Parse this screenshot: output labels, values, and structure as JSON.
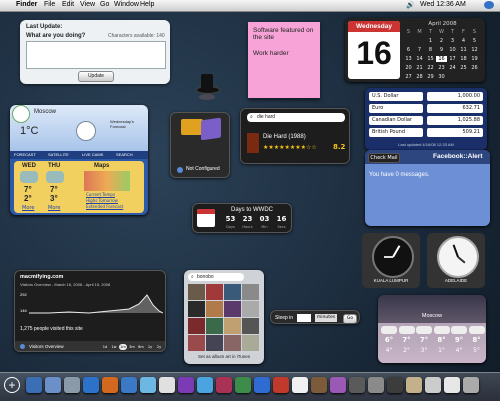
{
  "menubar": {
    "app": "Finder",
    "items": [
      "File",
      "Edit",
      "View",
      "Go",
      "Window",
      "Help"
    ],
    "clock": "Wed 12:36 AM"
  },
  "twitter": {
    "title": "Last Update:",
    "prompt": "What are you doing?",
    "chars": "Characters available: 140",
    "button": "Update"
  },
  "sticky": {
    "line1": "Software featured on the site",
    "line2": "Work harder"
  },
  "calendar": {
    "weekday": "Wednesday",
    "day": "16",
    "month": "April 2008",
    "dow": [
      "S",
      "M",
      "T",
      "W",
      "T",
      "F",
      "S"
    ],
    "weeks": [
      [
        "",
        "",
        "1",
        "2",
        "3",
        "4",
        "5"
      ],
      [
        "6",
        "7",
        "8",
        "9",
        "10",
        "11",
        "12"
      ],
      [
        "13",
        "14",
        "15",
        "16",
        "17",
        "18",
        "19"
      ],
      [
        "20",
        "21",
        "22",
        "23",
        "24",
        "25",
        "26"
      ],
      [
        "27",
        "28",
        "29",
        "30",
        "",
        "",
        ""
      ]
    ]
  },
  "weather": {
    "city": "Moscow",
    "temp": "1°C",
    "forecast_title": "Wednesday's Forecast",
    "tabs": [
      "FORECAST",
      "SATELLITE",
      "LIVE CAMS",
      "SEARCH"
    ],
    "days": [
      {
        "name": "WED",
        "hi": "7°",
        "lo": "2°",
        "link": "More"
      },
      {
        "name": "THU",
        "hi": "7°",
        "lo": "3°",
        "link": "More"
      }
    ],
    "maps_label": "Maps",
    "map_links": [
      "Current Temps",
      "Highs Tomorrow",
      "Extended Forecast"
    ]
  },
  "delivery": {
    "status": "Not Configured"
  },
  "movies": {
    "search": "die hard",
    "result_title": "Die Hard (1988)",
    "rating": "8.2"
  },
  "currency": {
    "rows": [
      {
        "name": "U.S. Dollar",
        "value": "1,000.00"
      },
      {
        "name": "Euro",
        "value": "632.71"
      },
      {
        "name": "Canadian Dollar",
        "value": "1,025.88"
      },
      {
        "name": "British Pound",
        "value": "509.21"
      }
    ],
    "footer": "Last updated 4/16/08 12:33 AM"
  },
  "facebook": {
    "button": "Check Mail",
    "title": "Facebook::Alert",
    "message": "You have 0 messages."
  },
  "countdown": {
    "title": "Days to WWDC",
    "values": [
      "53",
      "23",
      "03",
      "16"
    ],
    "labels": [
      "Days",
      "Hours",
      "Min",
      "Secs"
    ]
  },
  "clocks": [
    {
      "city": "KUALA LUMPUR"
    },
    {
      "city": "ADELAIDE"
    }
  ],
  "analytics": {
    "site": "macmifying.com",
    "subtitle": "Visitors Overview - March 16, 2008 - April 15, 2008",
    "ymax": "292",
    "ymin": "146",
    "visits": "1,275 people visited this site",
    "footer": "Visitors Overview",
    "ranges": [
      "1d",
      "1w",
      "1m",
      "3m",
      "6m",
      "1y",
      "2y"
    ]
  },
  "albumart": {
    "search": "bonobo",
    "caption": "Set as album art in iTunes"
  },
  "sleep": {
    "label": "Sleep in",
    "unit": "minutes",
    "button": "Go"
  },
  "weather2": {
    "city": "Moscow",
    "days": [
      {
        "hi": "6°",
        "lo": "4°"
      },
      {
        "hi": "7°",
        "lo": "2°"
      },
      {
        "hi": "7°",
        "lo": "3°"
      },
      {
        "hi": "8°",
        "lo": "1°"
      },
      {
        "hi": "9°",
        "lo": "4°"
      },
      {
        "hi": "8°",
        "lo": "5°"
      }
    ]
  },
  "dock": {
    "add_symbol": "+",
    "icons": [
      "#3a6fb5",
      "#6a8fc9",
      "#8b9aa8",
      "#2d72c9",
      "#d2691e",
      "#3b79c7",
      "#6cb7e3",
      "#e0e0e0",
      "#7a3bb5",
      "#4aa4e0",
      "#aa3355",
      "#3d8c4a",
      "#2f6bd1",
      "#c0392b",
      "#f0f0f0",
      "#7c5b3b",
      "#9b59b6",
      "#5a5a5a",
      "#8a8a8a",
      "#3c3c3c",
      "#c4b08a",
      "#cccccc",
      "#e7e7e7",
      "#aaaaaa"
    ]
  }
}
